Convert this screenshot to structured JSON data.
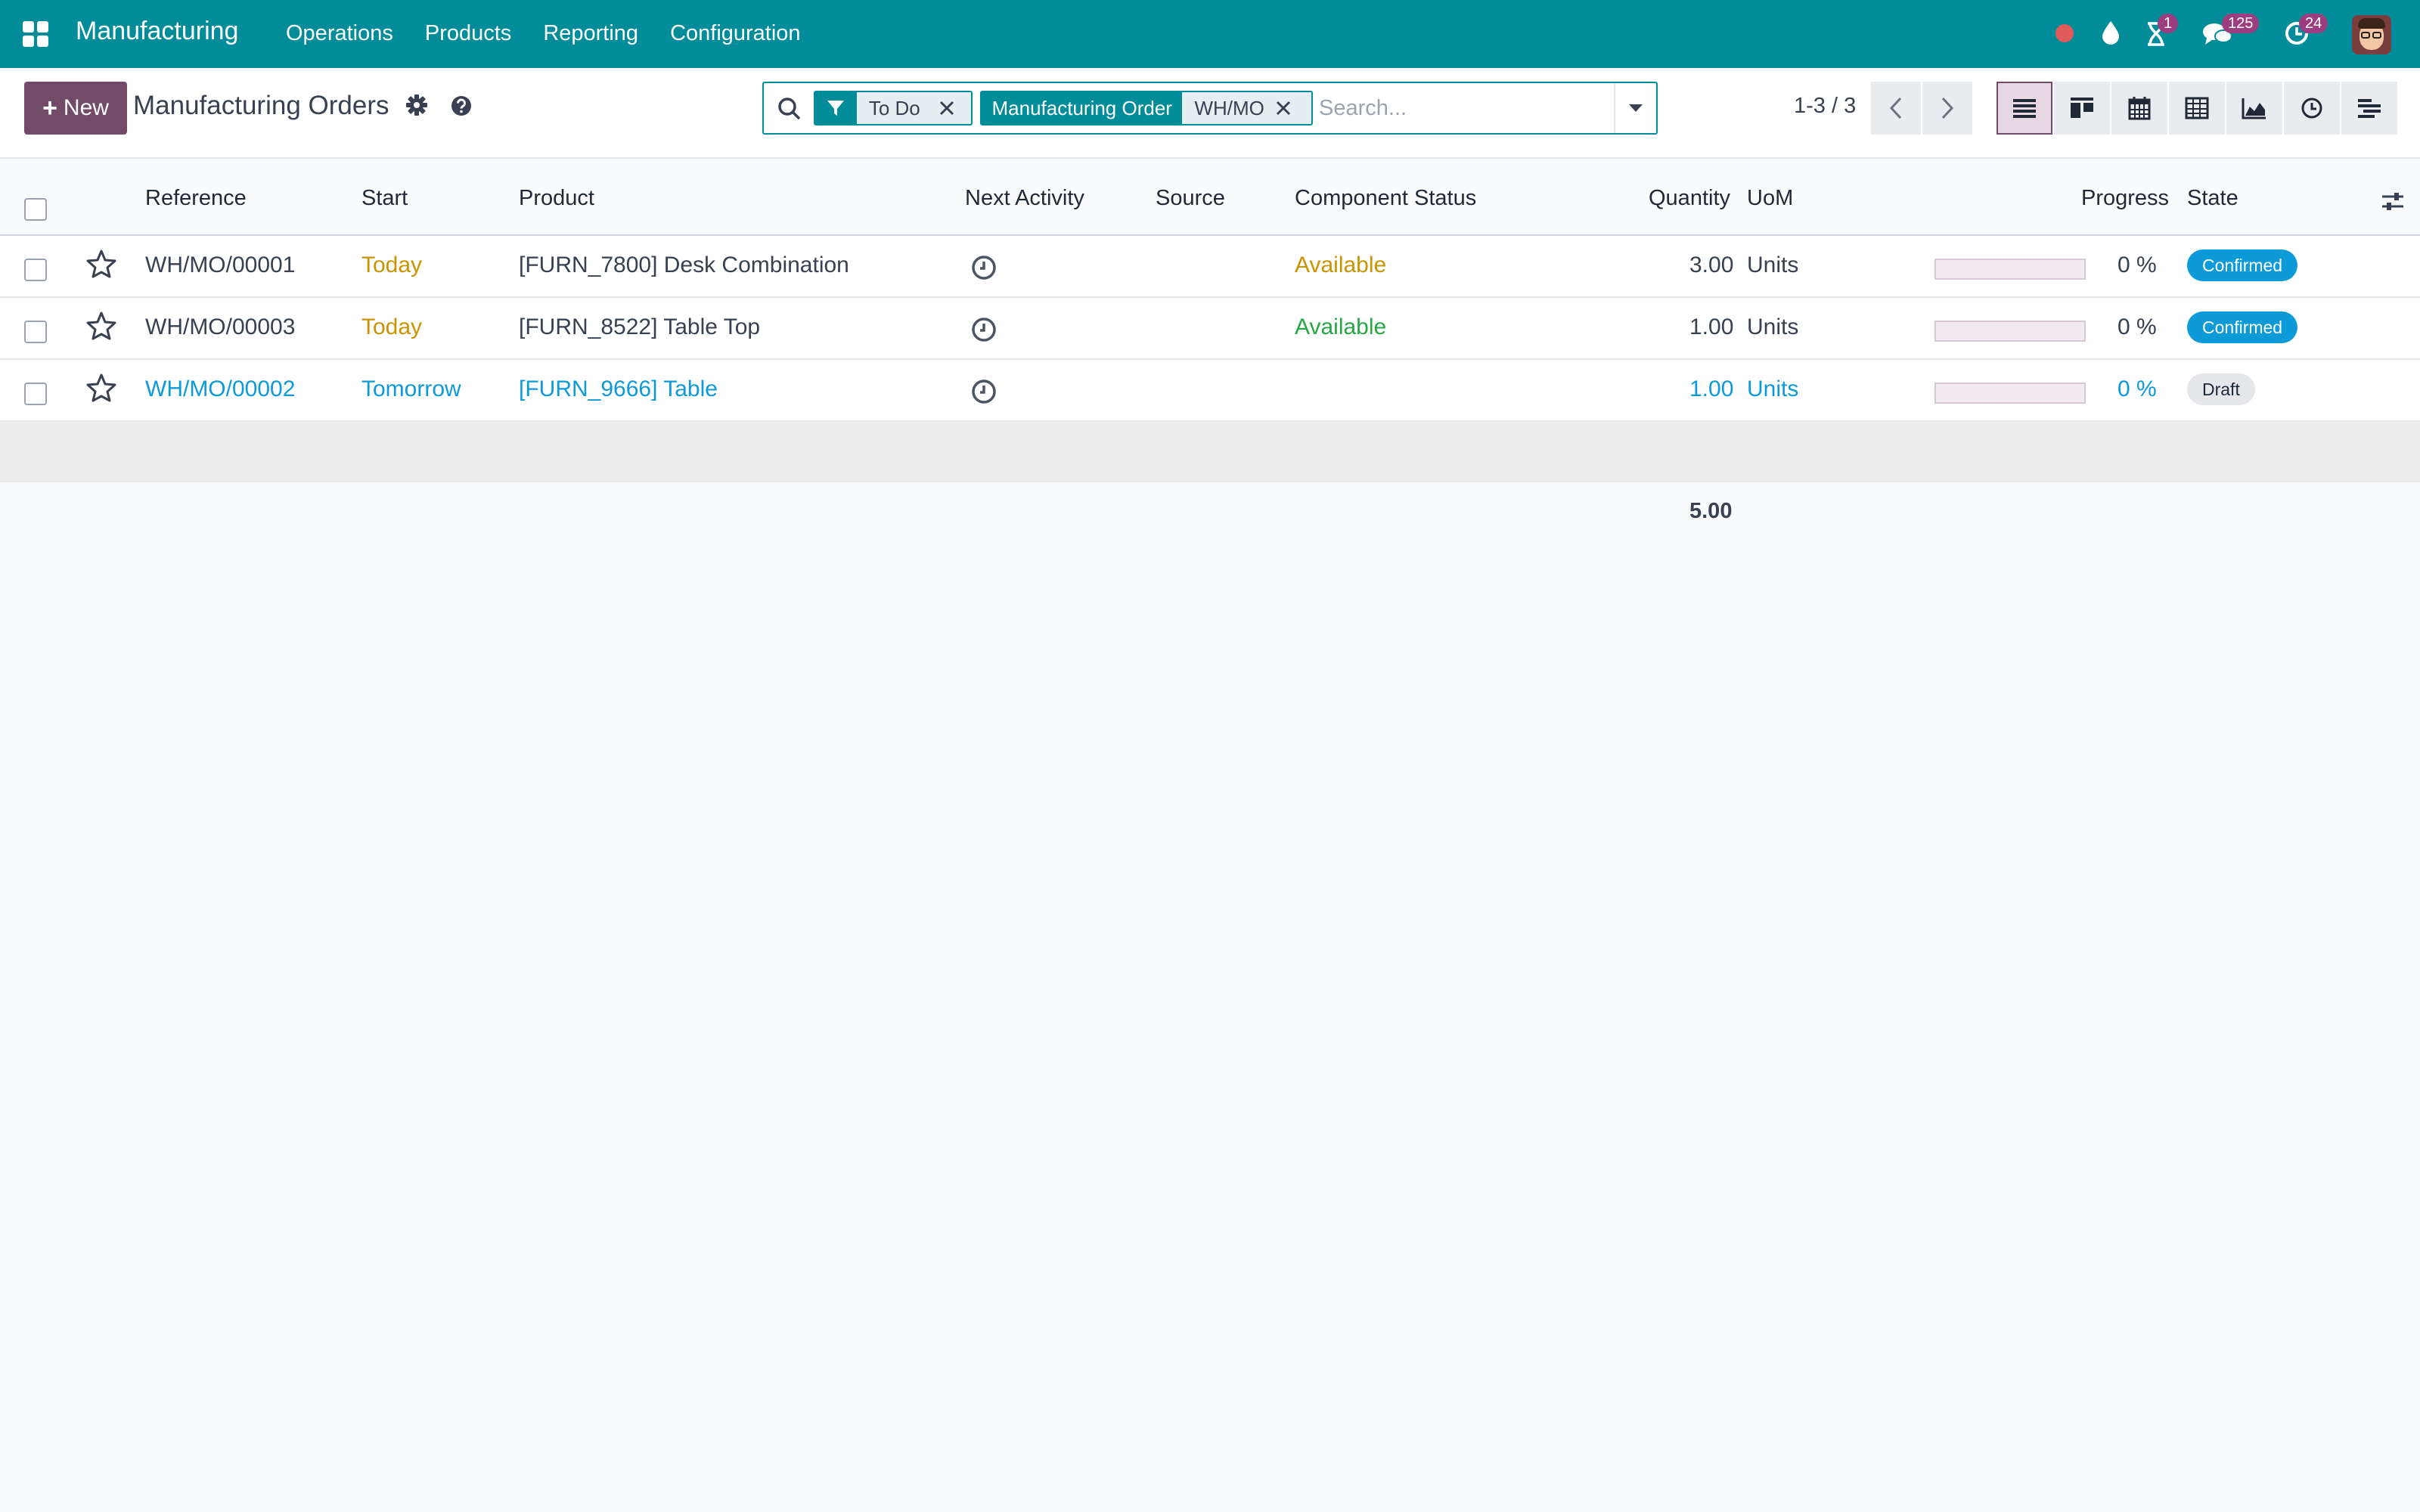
{
  "navbar": {
    "app_name": "Manufacturing",
    "menu": [
      "Operations",
      "Products",
      "Reporting",
      "Configuration"
    ],
    "badges": {
      "activity": "1",
      "discuss": "125",
      "timesheet": "24"
    }
  },
  "control": {
    "new_label": "New",
    "title": "Manufacturing Orders",
    "facets": [
      {
        "label": "To Do"
      },
      {
        "category": "Manufacturing Order",
        "label": "WH/MO"
      }
    ],
    "search_placeholder": "Search...",
    "pager": "1-3 / 3"
  },
  "table": {
    "headers": {
      "reference": "Reference",
      "start": "Start",
      "product": "Product",
      "next_activity": "Next Activity",
      "source": "Source",
      "component_status": "Component Status",
      "quantity": "Quantity",
      "uom": "UoM",
      "progress": "Progress",
      "state": "State"
    },
    "rows": [
      {
        "reference": "WH/MO/00001",
        "start": "Today",
        "product": "[FURN_7800] Desk Combination",
        "source": "",
        "component_status": "Available",
        "quantity": "3.00",
        "uom": "Units",
        "progress": "0 %",
        "progress_value": 0,
        "state": "Confirmed"
      },
      {
        "reference": "WH/MO/00003",
        "start": "Today",
        "product": "[FURN_8522] Table Top",
        "source": "",
        "component_status": "Available",
        "quantity": "1.00",
        "uom": "Units",
        "progress": "0 %",
        "progress_value": 0,
        "state": "Confirmed"
      },
      {
        "reference": "WH/MO/00002",
        "start": "Tomorrow",
        "product": "[FURN_9666] Table",
        "source": "",
        "component_status": "",
        "quantity": "1.00",
        "uom": "Units",
        "progress": "0 %",
        "progress_value": 0,
        "state": "Draft"
      }
    ],
    "total_quantity": "5.00"
  },
  "colors": {
    "navbar": "#018c99",
    "primary": "#714b67",
    "today": "#c99400",
    "available_warning": "#c99400",
    "available_ok": "#28a745",
    "link": "#0d9ad9"
  }
}
